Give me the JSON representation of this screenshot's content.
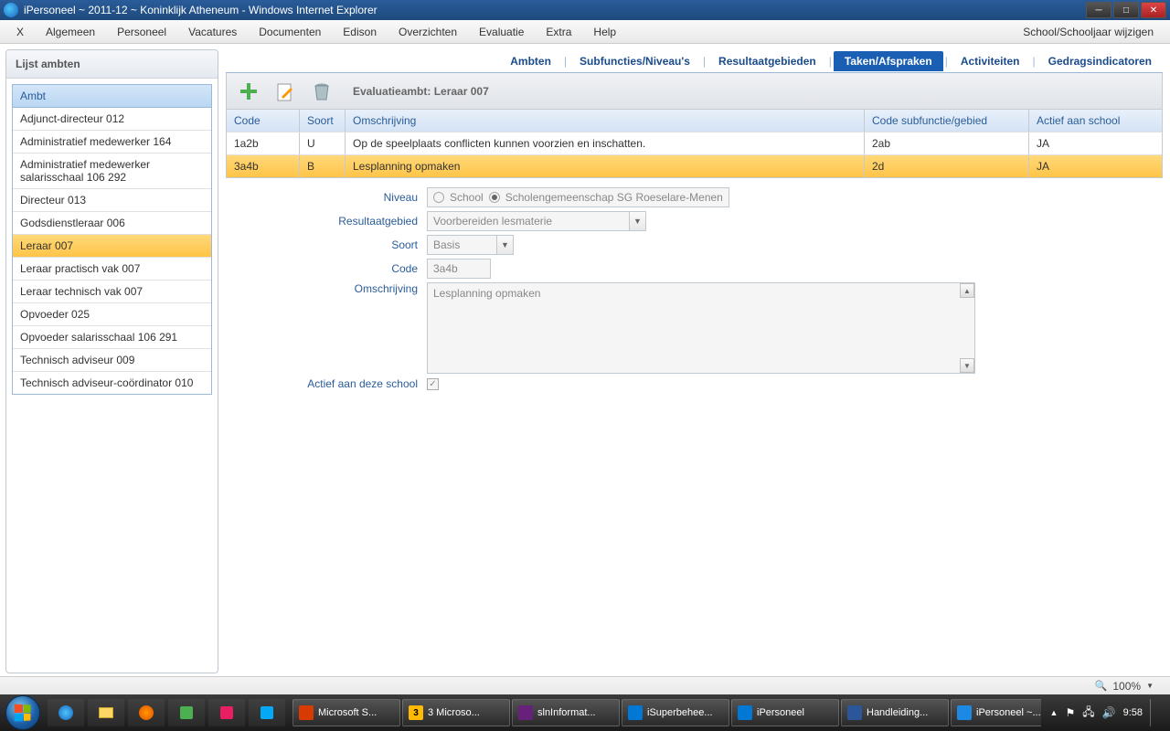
{
  "window": {
    "title": "iPersoneel ~ 2011-12 ~ Koninklijk Atheneum - Windows Internet Explorer"
  },
  "menubar": {
    "items": [
      "X",
      "Algemeen",
      "Personeel",
      "Vacatures",
      "Documenten",
      "Edison",
      "Overzichten",
      "Evaluatie",
      "Extra",
      "Help"
    ],
    "right": "School/Schooljaar wijzigen"
  },
  "sidebar": {
    "title": "Lijst ambten",
    "header": "Ambt",
    "items": [
      "Adjunct-directeur 012",
      "Administratief medewerker 164",
      "Administratief medewerker salarisschaal 106 292",
      "Directeur 013",
      "Godsdienstleraar 006",
      "Leraar 007",
      "Leraar practisch vak 007",
      "Leraar technisch vak 007",
      "Opvoeder 025",
      "Opvoeder salarisschaal 106 291",
      "Technisch adviseur 009",
      "Technisch adviseur-coördinator 010"
    ],
    "selected_index": 5
  },
  "tabs": {
    "items": [
      "Ambten",
      "Subfuncties/Niveau's",
      "Resultaatgebieden",
      "Taken/Afspraken",
      "Activiteiten",
      "Gedragsindicatoren"
    ],
    "active_index": 3
  },
  "toolbar": {
    "label": "Evaluatieambt: Leraar 007"
  },
  "grid": {
    "headers": {
      "code": "Code",
      "soort": "Soort",
      "omschr": "Omschrijving",
      "subf": "Code subfunctie/gebied",
      "actief": "Actief aan school"
    },
    "rows": [
      {
        "code": "1a2b",
        "soort": "U",
        "omschr": "Op de speelplaats conflicten kunnen voorzien en inschatten.",
        "subf": "2ab",
        "actief": "JA"
      },
      {
        "code": "3a4b",
        "soort": "B",
        "omschr": "Lesplanning opmaken",
        "subf": "2d",
        "actief": "JA"
      }
    ],
    "selected_index": 1
  },
  "form": {
    "labels": {
      "niveau": "Niveau",
      "resultaatgebied": "Resultaatgebied",
      "soort": "Soort",
      "code": "Code",
      "omschrijving": "Omschrijving",
      "actief": "Actief aan deze school"
    },
    "niveau": {
      "option1": "School",
      "option2": "Scholengemeenschap SG Roeselare-Menen",
      "selected": 2
    },
    "resultaatgebied": "Voorbereiden lesmaterie",
    "soort": "Basis",
    "code": "3a4b",
    "omschrijving": "Lesplanning opmaken",
    "actief": true
  },
  "ie_status": {
    "zoom": "100%"
  },
  "taskbar": {
    "items": [
      {
        "label": "Microsoft S...",
        "color": "#d83b01"
      },
      {
        "label": "3 Microso...",
        "color": "#ffb900",
        "badge": "3"
      },
      {
        "label": "slnInformat...",
        "color": "#68217a"
      },
      {
        "label": "iSuperbehee...",
        "color": "#0078d4"
      },
      {
        "label": "iPersoneel",
        "color": "#0078d4"
      },
      {
        "label": "Handleiding...",
        "color": "#2b579a"
      },
      {
        "label": "iPersoneel ~...",
        "color": "#1e88e5"
      }
    ],
    "time": "9:58"
  }
}
